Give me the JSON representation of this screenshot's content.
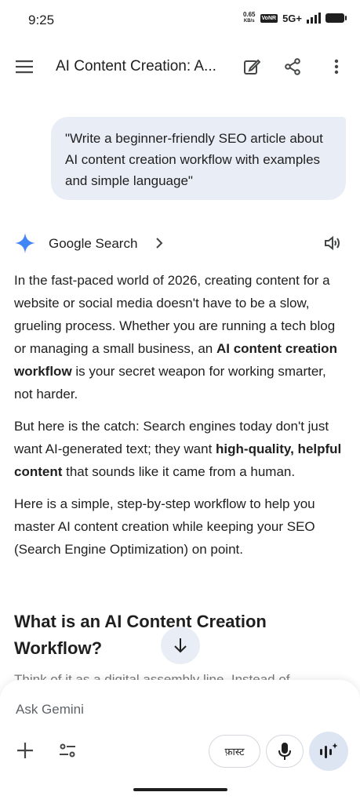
{
  "status_bar": {
    "time": "9:25",
    "net_speed_value": "0.65",
    "net_speed_unit": "KB/s",
    "volte": "VoNR",
    "network": "5G+",
    "signal_icon": "signal-bars-icon",
    "battery_icon": "battery-icon"
  },
  "app_bar": {
    "title": "AI Content Creation: A...",
    "menu_icon": "hamburger-menu-icon",
    "edit_icon": "edit-icon",
    "share_icon": "share-icon",
    "more_icon": "more-vertical-icon"
  },
  "prompt": {
    "text": "\"Write a beginner-friendly SEO article about AI content creation workflow with examples and simple language\""
  },
  "response": {
    "source_label": "Google Search",
    "para1_pre": "In the fast-paced world of 2026, creating content for a website or social media doesn't have to be a slow, grueling process. Whether you are running a tech blog or managing a small business, an ",
    "para1_bold": "AI content creation workflow",
    "para1_post": " is your secret weapon for working smarter, not harder.",
    "para2_pre": "But here is the catch: Search engines today don't just want AI-generated text; they want ",
    "para2_bold": "high-quality, helpful content",
    "para2_post": " that sounds like it came from a human.",
    "para3": "Here is a simple, step-by-step workflow to help you master AI content creation while keeping your SEO (Search Engine Optimization) on point.",
    "heading": "What is an AI Content Creation Workflow?",
    "partial_line": "Think of it as a digital assembly line. Instead of"
  },
  "input": {
    "placeholder": "Ask Gemini",
    "mode_chip": "फ़ास्ट"
  },
  "colors": {
    "bubble_bg": "#e9eef6",
    "gemini_blue": "#4285f4",
    "live_btn_bg": "#dde5f3"
  }
}
